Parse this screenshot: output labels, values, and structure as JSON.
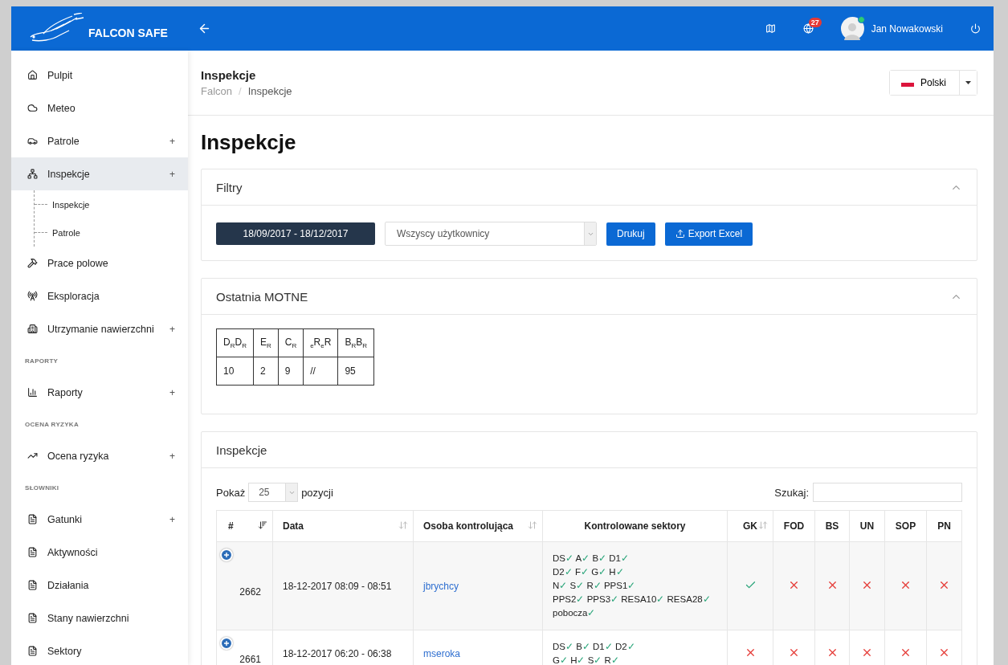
{
  "brand": {
    "name": "FALCON SAFE"
  },
  "topbar": {
    "notifications": "27",
    "user": {
      "name": "Jan Nowakowski",
      "online": true
    }
  },
  "sidebar": {
    "items": [
      {
        "kind": "item",
        "label": "Pulpit",
        "selected": false
      },
      {
        "kind": "item",
        "label": "Meteo",
        "selected": false
      },
      {
        "kind": "item",
        "label": "Patrole",
        "selected": false,
        "expander": "+"
      },
      {
        "kind": "item",
        "label": "Inspekcje",
        "selected": true,
        "expander": "+",
        "expanded": true,
        "children": [
          {
            "label": "Inspekcje"
          },
          {
            "label": "Patrole"
          }
        ]
      },
      {
        "kind": "item",
        "label": "Prace polowe",
        "selected": false
      },
      {
        "kind": "item",
        "label": "Eksploracja",
        "selected": false
      },
      {
        "kind": "item",
        "label": "Utrzymanie nawierzchni",
        "selected": false,
        "expander": "+"
      },
      {
        "kind": "section",
        "label": "RAPORTY"
      },
      {
        "kind": "item",
        "label": "Raporty",
        "selected": false,
        "expander": "+"
      },
      {
        "kind": "section",
        "label": "OCENA RYZYKA"
      },
      {
        "kind": "item",
        "label": "Ocena ryzyka",
        "selected": false,
        "expander": "+"
      },
      {
        "kind": "section",
        "label": "SŁOWNIKI"
      },
      {
        "kind": "item",
        "label": "Gatunki",
        "selected": false,
        "expander": "+"
      },
      {
        "kind": "item",
        "label": "Aktywności",
        "selected": false
      },
      {
        "kind": "item",
        "label": "Działania",
        "selected": false
      },
      {
        "kind": "item",
        "label": "Stany nawierzchni",
        "selected": false
      },
      {
        "kind": "item",
        "label": "Sektory",
        "selected": false
      }
    ]
  },
  "page_header": {
    "title": "Inspekcje",
    "breadcrumb": [
      "Falcon",
      "Inspekcje"
    ],
    "breadcrumb_separator": "/",
    "language": "Polski"
  },
  "title": "Inspekcje",
  "filters": {
    "title": "Filtry",
    "date_range": "18/09/2017 - 18/12/2017",
    "user_select": "Wszyscy użytkownicy",
    "print_button": "Drukuj",
    "export_button": "Export Excel"
  },
  "motne": {
    "title": "Ostatnia MOTNE",
    "headers": [
      "D$_{R}$D$_{R}$",
      "E$_{R}$",
      "C$_{R}$",
      "$_{e}$R$_{e}$R",
      "B$_{R}$B$_{R}$"
    ],
    "values": [
      "10",
      "2",
      "9",
      "//",
      "95"
    ]
  },
  "inspections": {
    "title": "Inspekcje",
    "show_label": "Pokaż",
    "page_size": "25",
    "entries_label": "pozycji",
    "search_label": "Szukaj:",
    "columns": [
      {
        "label": "#",
        "sortable": true,
        "sorted": true
      },
      {
        "label": "Data",
        "sortable": true,
        "sorted": false
      },
      {
        "label": "Osoba kontrolująca",
        "sortable": true,
        "sorted": false
      },
      {
        "label": "Kontrolowane sektory",
        "sortable": false
      },
      {
        "label": "GK",
        "sortable": true,
        "sorted": false
      },
      {
        "label": "FOD",
        "sortable": false
      },
      {
        "label": "BS",
        "sortable": false
      },
      {
        "label": "UN",
        "sortable": false
      },
      {
        "label": "SOP",
        "sortable": false
      },
      {
        "label": "PN",
        "sortable": false
      }
    ],
    "rows": [
      {
        "id": "2662",
        "date": "18-12-2017 08:09 - 08:51",
        "user": "jbrychcy",
        "sectors": [
          [
            {
              "name": "DS",
              "mark": "✓"
            },
            {
              "name": "A",
              "mark": "✓"
            },
            {
              "name": "B",
              "mark": "✓"
            },
            {
              "name": "D1",
              "mark": "✓"
            }
          ],
          [
            {
              "name": "D2",
              "mark": "✓"
            },
            {
              "name": "F",
              "mark": "✓"
            },
            {
              "name": "G",
              "mark": "✓"
            },
            {
              "name": "H",
              "mark": "✓"
            }
          ],
          [
            {
              "name": "N",
              "mark": "✓"
            },
            {
              "name": "S",
              "mark": "✓"
            },
            {
              "name": "R",
              "mark": "✓"
            },
            {
              "name": "PPS1",
              "mark": "✓"
            }
          ],
          [
            {
              "name": "PPS2",
              "mark": "✓"
            },
            {
              "name": "PPS3",
              "mark": "✓"
            },
            {
              "name": "RESA10",
              "mark": "✓"
            },
            {
              "name": "RESA28",
              "mark": "✓"
            }
          ],
          [
            {
              "name": "pobocza",
              "mark": "✓"
            }
          ]
        ],
        "checks": [
          true,
          false,
          false,
          false,
          false,
          false
        ]
      },
      {
        "id": "2661",
        "date": "18-12-2017 06:20 - 06:38",
        "user": "mseroka",
        "sectors": [
          [
            {
              "name": "DS",
              "mark": "✓"
            },
            {
              "name": "B",
              "mark": "✓"
            },
            {
              "name": "D1",
              "mark": "✓"
            },
            {
              "name": "D2",
              "mark": "✓"
            }
          ],
          [
            {
              "name": "G",
              "mark": "✓"
            },
            {
              "name": "H",
              "mark": "✓"
            },
            {
              "name": "S",
              "mark": "✓"
            },
            {
              "name": "R",
              "mark": "✓"
            }
          ]
        ],
        "checks": [
          false,
          false,
          false,
          false,
          false,
          false
        ]
      }
    ]
  }
}
